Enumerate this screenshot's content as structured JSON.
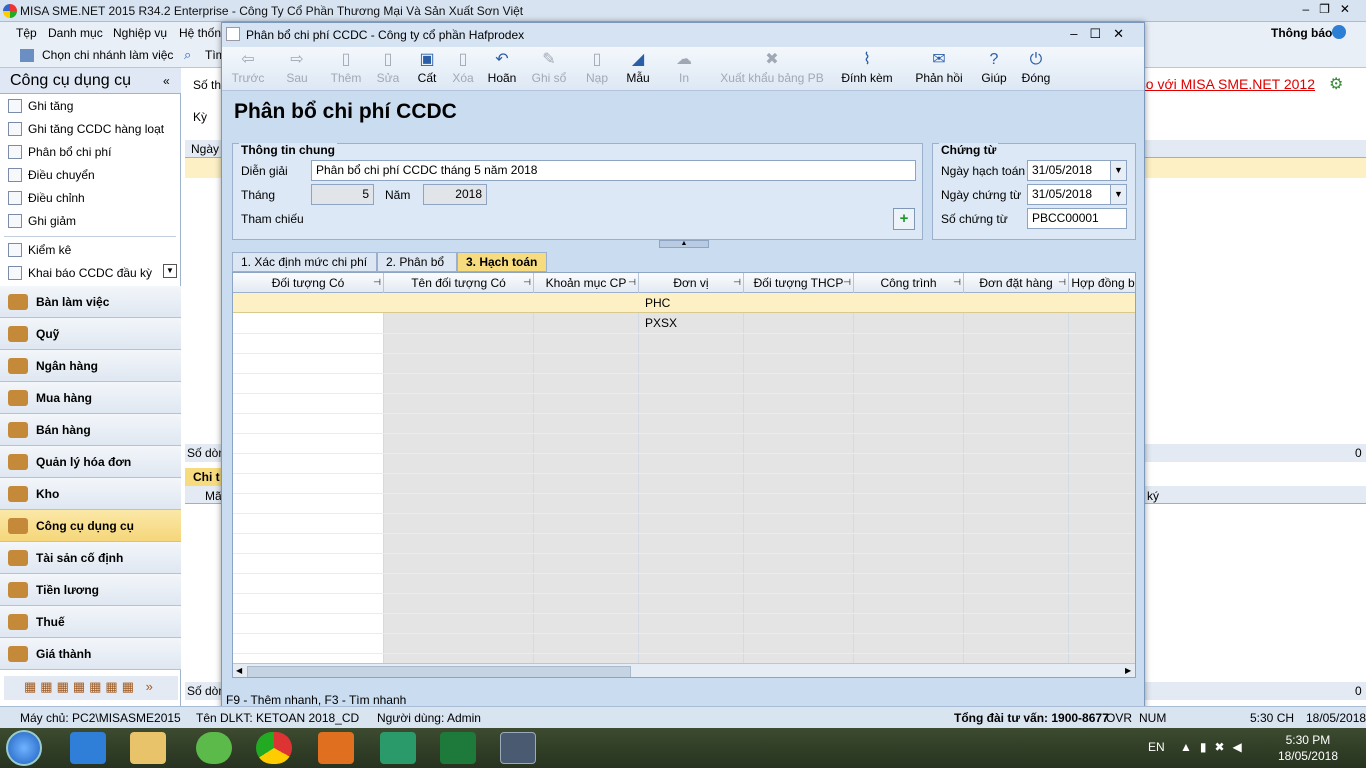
{
  "app": {
    "title": "MISA SME.NET 2015 R34.2 Enterprise - Công Ty Cổ Phần Thương Mại Và Sản Xuất Sơn Việt",
    "menu": [
      "Tệp",
      "Danh mục",
      "Nghiệp vụ",
      "Hệ thốn"
    ],
    "branch_label": "Chọn chi nhánh làm việc",
    "search_partial": "Tìm",
    "notify": "Thông báo",
    "compare_link": "ối so với MISA SME.NET 2012",
    "bg_labels": {
      "so": "Số th",
      "ky": "Kỳ",
      "ngay": "Ngày",
      "sodong1": "Số dòn",
      "zero1": "0",
      "chi": "Chi t",
      "ma": "Mã",
      "ky2": "ký",
      "sodong2": "Số dòn",
      "zero2": "0"
    }
  },
  "sidebar": {
    "title": "Công cụ dụng cụ",
    "items": [
      "Ghi tăng",
      "Ghi tăng CCDC hàng loạt",
      "Phân bổ chi phí",
      "Điều chuyển",
      "Điều chỉnh",
      "Ghi giảm",
      "Kiểm kê",
      "Khai báo CCDC đầu kỳ"
    ],
    "modules": [
      "Bàn làm việc",
      "Quỹ",
      "Ngân hàng",
      "Mua hàng",
      "Bán hàng",
      "Quản lý hóa đơn",
      "Kho",
      "Công cụ dụng cụ",
      "Tài sản cố định",
      "Tiền lương",
      "Thuế",
      "Giá thành"
    ],
    "active_module": "Công cụ dụng cụ"
  },
  "dialog": {
    "title": "Phân bổ chi phí CCDC - Công ty cổ phần Hafprodex",
    "toolbar": [
      {
        "label": "Trước",
        "icon": "arrow-left-icon",
        "glyph": "⇦",
        "enabled": false
      },
      {
        "label": "Sau",
        "icon": "arrow-right-icon",
        "glyph": "⇨",
        "enabled": false
      },
      {
        "label": "Thêm",
        "icon": "add-doc-icon",
        "glyph": "▯",
        "enabled": false
      },
      {
        "label": "Sửa",
        "icon": "edit-doc-icon",
        "glyph": "▯",
        "enabled": false
      },
      {
        "label": "Cất",
        "icon": "save-icon",
        "glyph": "▣",
        "enabled": true
      },
      {
        "label": "Xóa",
        "icon": "delete-icon",
        "glyph": "▯",
        "enabled": false
      },
      {
        "label": "Hoãn",
        "icon": "undo-icon",
        "glyph": "↶",
        "enabled": true
      },
      {
        "label": "Ghi sổ",
        "icon": "pen-icon",
        "glyph": "✎",
        "enabled": false
      },
      {
        "label": "Nạp",
        "icon": "reload-icon",
        "glyph": "▯",
        "enabled": false
      },
      {
        "label": "Mẫu",
        "icon": "template-icon",
        "glyph": "◢",
        "enabled": true
      },
      {
        "label": "In",
        "icon": "print-icon",
        "glyph": "☁",
        "enabled": false
      },
      {
        "label": "Xuất khẩu bảng PB",
        "icon": "export-icon",
        "glyph": "✖",
        "enabled": false
      },
      {
        "label": "Đính kèm",
        "icon": "paperclip-icon",
        "glyph": "⌇",
        "enabled": true
      },
      {
        "label": "Phản hồi",
        "icon": "mail-icon",
        "glyph": "✉",
        "enabled": true
      },
      {
        "label": "Giúp",
        "icon": "help-icon",
        "glyph": "?",
        "enabled": true
      },
      {
        "label": "Đóng",
        "icon": "power-icon",
        "glyph": "⏻",
        "enabled": true
      }
    ],
    "heading": "Phân bổ chi phí CCDC",
    "general": {
      "title": "Thông tin chung",
      "desc_label": "Diễn giải",
      "desc_value": "Phân bổ chi phí CCDC tháng 5 năm 2018",
      "month_label": "Tháng",
      "month_value": "5",
      "year_label": "Năm",
      "year_value": "2018",
      "ref_label": "Tham chiếu"
    },
    "voucher": {
      "title": "Chứng từ",
      "post_date_label": "Ngày hạch toán",
      "post_date": "31/05/2018",
      "doc_date_label": "Ngày chứng từ",
      "doc_date": "31/05/2018",
      "doc_no_label": "Số chứng từ",
      "doc_no": "PBCC00001"
    },
    "tabs": [
      "1. Xác định mức chi phí",
      "2. Phân bổ",
      "3. Hạch toán"
    ],
    "active_tab": "3. Hạch toán",
    "grid": {
      "headers": [
        "Đối tượng Có",
        "Tên đối tượng Có",
        "Khoản mục CP",
        "Đơn vị",
        "Đối tượng THCP",
        "Công trình",
        "Đơn đặt hàng",
        "Hợp đồng b"
      ],
      "rows": [
        [
          "",
          "",
          "",
          "PHC",
          "",
          "",
          "",
          ""
        ],
        [
          "",
          "",
          "",
          "PXSX",
          "",
          "",
          "",
          ""
        ]
      ]
    },
    "hint": "F9 - Thêm nhanh, F3 - Tìm nhanh"
  },
  "statusbar": {
    "server": "Máy chủ: PC2\\MISASME2015",
    "db": "Tên DLKT: KETOAN 2018_CD",
    "user": "Người dùng: Admin",
    "hotline": "Tổng đài tư vấn: 1900-8677",
    "ovr": "OVR",
    "num": "NUM",
    "time": "5:30 CH",
    "date": "18/05/2018"
  },
  "taskbar": {
    "lang": "EN",
    "time": "5:30 PM",
    "date": "18/05/2018"
  }
}
